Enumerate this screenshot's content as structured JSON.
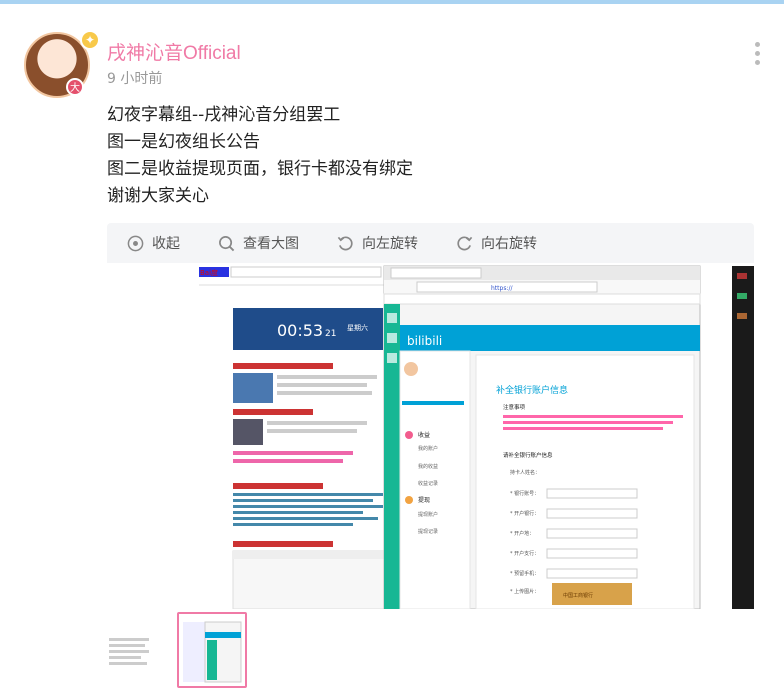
{
  "user": {
    "name": "戌神沁音Official",
    "time": "9 小时前",
    "badge": "大"
  },
  "post": {
    "lines": [
      "幻夜字幕组--戌神沁音分组罢工",
      "图一是幻夜组长公告",
      "图二是收益提现页面，银行卡都没有绑定",
      "谢谢大家关心"
    ]
  },
  "toolbar": {
    "collapse": "收起",
    "view_large": "查看大图",
    "rotate_left": "向左旋转",
    "rotate_right": "向右旋转"
  },
  "screenshot": {
    "clock": "00:53",
    "clock_sec": "21",
    "weekday": "星期六",
    "bilibili_title": "补全银行账户信息",
    "notice_title": "注意事项",
    "fill_title": "请补全银行账户信息",
    "sidebar": [
      "我的账户",
      "我的收益",
      "收益记录",
      "提现",
      "提现账户",
      "提现记录"
    ],
    "form_labels": [
      "持卡人姓名：",
      "* 银行账号：",
      "* 开户银行：",
      "* 开户地：",
      "* 开户支行：",
      "* 预留手机：",
      "* 上传图片："
    ],
    "url_hint": "https://",
    "bank_card_label": "中国工商银行"
  },
  "colors": {
    "accent": "#f07aa6",
    "bili_blue": "#00a1d6",
    "baidu_blue": "#2932e1"
  },
  "thumbnails": {
    "count": 2,
    "selected": 2
  }
}
